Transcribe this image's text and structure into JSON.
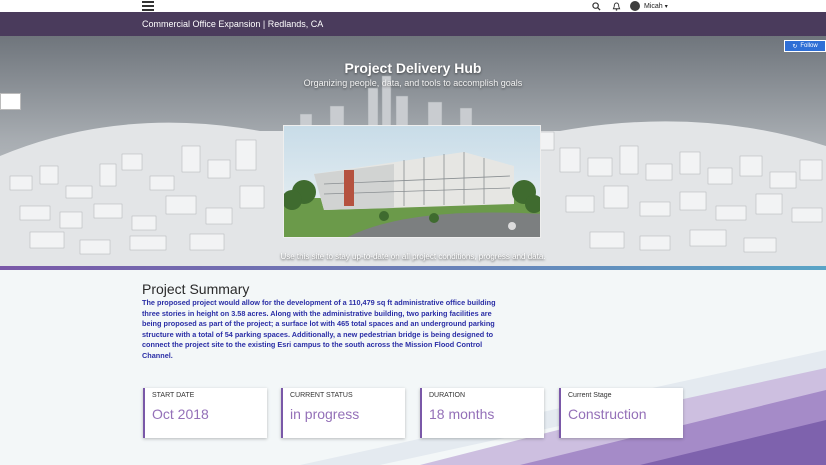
{
  "header": {
    "user_name": "Micah",
    "site_title": "Commercial Office Expansion | Redlands, CA"
  },
  "hero": {
    "title": "Project Delivery Hub",
    "subtitle": "Organizing people, data, and tools to accomplish goals",
    "caption": "Use this site to stay up-to-date on all project conditions, progress and data.",
    "follow_label": "Follow"
  },
  "summary": {
    "title": "Project Summary",
    "body": "The proposed project would allow for the development of a 110,479 sq ft administrative office building three stories in height on 3.58 acres. Along with the administrative building, two parking facilities are being proposed as part of the project; a surface lot with 465 total spaces and an underground parking structure with a total of 54 parking spaces. Additionally, a new pedestrian bridge is being designed to connect the project site to the existing Esri campus to the south across the Mission Flood Control Channel."
  },
  "cards": [
    {
      "label": "START DATE",
      "value": "Oct 2018"
    },
    {
      "label": "CURRENT STATUS",
      "value": "in progress"
    },
    {
      "label": "DURATION",
      "value": "18 months"
    },
    {
      "label": "Current Stage",
      "value": "Construction"
    }
  ],
  "icons": {
    "menu": "hamburger-menu-icon",
    "search": "search-icon",
    "notifications": "bell-icon",
    "user": "avatar",
    "follow": "follow-icon"
  },
  "colors": {
    "title_bar": "#4a3b5c",
    "accent": "#7a58a8",
    "follow_button": "#2f6fd6",
    "summary_text": "#2b2fa6",
    "card_value": "#9470b8"
  }
}
